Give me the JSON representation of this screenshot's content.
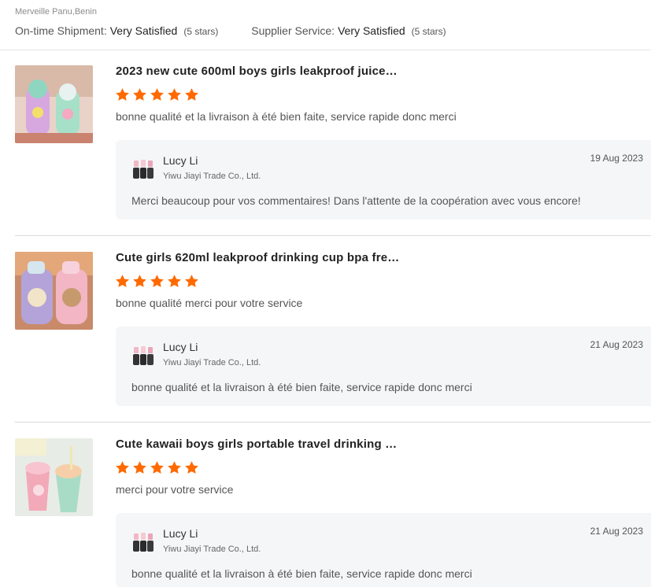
{
  "header": {
    "reviewer": "Merveille Panu,Benin",
    "ratings": [
      {
        "label": "On-time Shipment:",
        "value": "Very Satisfied",
        "note": "(5 stars)"
      },
      {
        "label": "Supplier Service:",
        "value": "Very Satisfied",
        "note": "(5 stars)"
      }
    ]
  },
  "colors": {
    "star": "#ff6a00",
    "reply_bg": "#f5f6f8"
  },
  "reviews": [
    {
      "title": "2023 new cute 600ml boys girls leakproof juice…",
      "stars": 5,
      "comment": "bonne qualité et la livraison à été bien faite, service rapide donc merci",
      "reply": {
        "name": "Lucy Li",
        "company": "Yiwu Jiayi Trade Co., Ltd.",
        "date": "19 Aug 2023",
        "text": "Merci beaucoup pour vos commentaires! Dans l'attente de la coopération avec vous encore!"
      }
    },
    {
      "title": "Cute girls 620ml leakproof drinking cup bpa fre…",
      "stars": 5,
      "comment": "bonne qualité merci pour votre service",
      "reply": {
        "name": "Lucy Li",
        "company": "Yiwu Jiayi Trade Co., Ltd.",
        "date": "21 Aug 2023",
        "text": "bonne qualité et la livraison à été bien faite, service rapide donc merci"
      }
    },
    {
      "title": "Cute kawaii boys girls portable travel drinking …",
      "stars": 5,
      "comment": "merci pour votre service",
      "reply": {
        "name": "Lucy Li",
        "company": "Yiwu Jiayi Trade Co., Ltd.",
        "date": "21 Aug 2023",
        "text": "bonne qualité et la livraison à été bien faite, service rapide donc merci"
      }
    }
  ]
}
